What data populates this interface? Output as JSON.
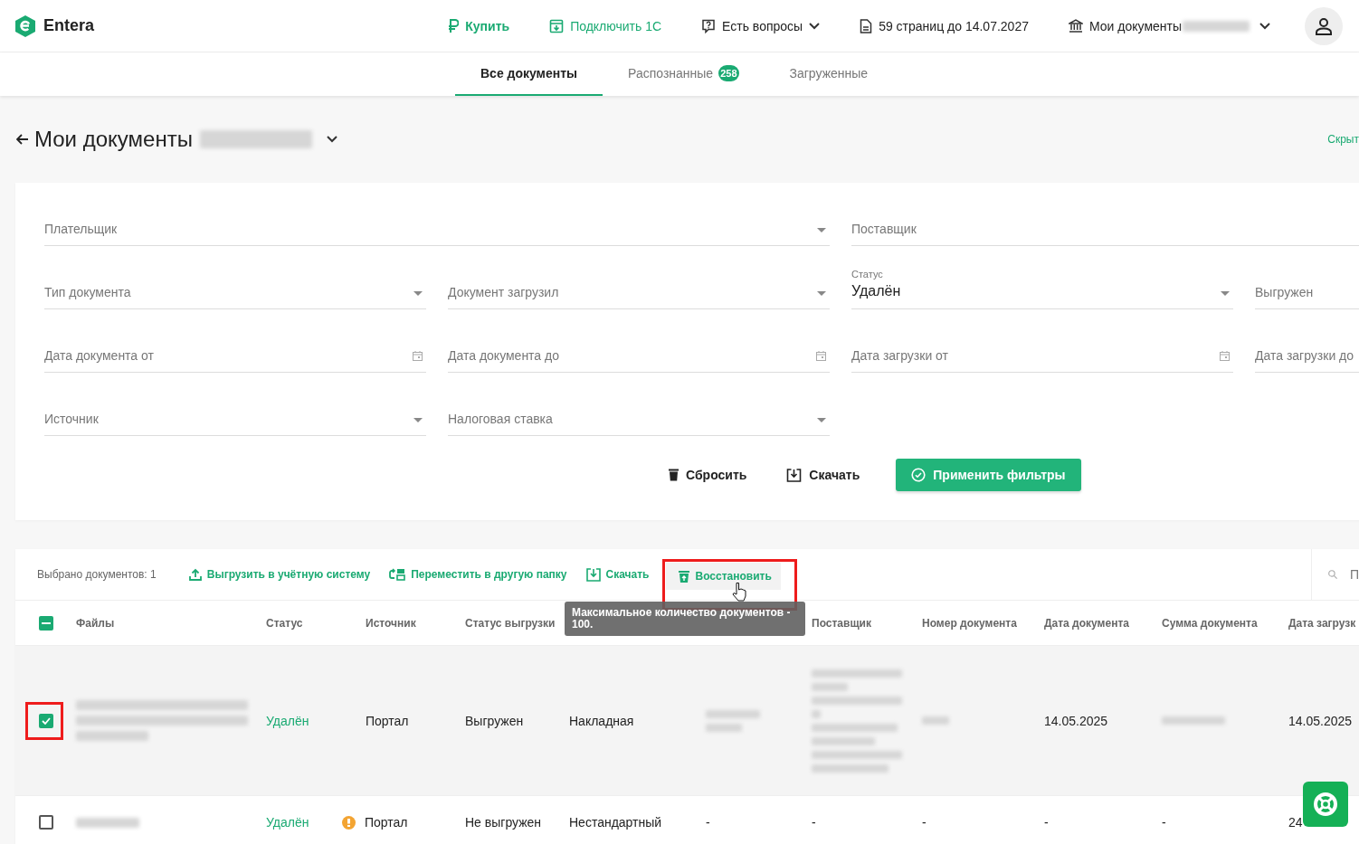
{
  "header": {
    "logo": "Entera",
    "nav": [
      {
        "kind": "buy",
        "label": "Купить"
      },
      {
        "kind": "connect",
        "label": "Подключить 1С"
      },
      {
        "kind": "help",
        "label": "Есть вопросы"
      },
      {
        "kind": "pages",
        "label": "59 страниц до 14.07.2027"
      },
      {
        "kind": "docs",
        "label": "Мои документы"
      }
    ]
  },
  "tabs": [
    {
      "label": "Все документы",
      "selected": true
    },
    {
      "label": "Распознанные",
      "badge": "258",
      "selected": false
    },
    {
      "label": "Загруженные",
      "selected": false
    }
  ],
  "page_title": "Мои документы",
  "hide_link": "Скрыт",
  "filter_rows": [
    [
      {
        "kind": "select",
        "label": "Плательщик"
      },
      {
        "kind": "text",
        "label": "Поставщик"
      }
    ],
    [
      {
        "kind": "select",
        "label": "Тип документа"
      },
      {
        "kind": "select",
        "label": "Документ загрузил"
      },
      {
        "kind": "select",
        "label": "Статус",
        "value": "Удалён"
      },
      {
        "kind": "text",
        "label": "Выгружен"
      }
    ],
    [
      {
        "kind": "date",
        "label": "Дата документа от"
      },
      {
        "kind": "date",
        "label": "Дата документа до"
      },
      {
        "kind": "date",
        "label": "Дата загрузки от"
      },
      {
        "kind": "text",
        "label": "Дата загрузки до"
      }
    ],
    [
      {
        "kind": "select",
        "label": "Источник"
      },
      {
        "kind": "select",
        "label": "Налоговая ставка"
      }
    ]
  ],
  "filter_buttons": [
    {
      "kind": "reset",
      "label": "Сбросить"
    },
    {
      "kind": "download",
      "label": "Скачать"
    },
    {
      "kind": "apply",
      "label": "Применить фильтры"
    }
  ],
  "toolbar": {
    "selected_count": "Выбрано документов: 1",
    "actions": [
      {
        "kind": "upload",
        "label": "Выгрузить в учётную систему",
        "highlighted": false
      },
      {
        "kind": "move",
        "label": "Переместить в другую папку",
        "highlighted": false
      },
      {
        "kind": "download",
        "label": "Скачать",
        "highlighted": false
      },
      {
        "kind": "restore",
        "label": "Восстановить",
        "highlighted": true
      }
    ],
    "tooltip": "Максимальное количество документов - 100.",
    "search_placeholder": "П"
  },
  "table": {
    "select_all_partial": true,
    "columns": [
      "Файлы",
      "Статус",
      "Источник",
      "Статус выгрузки"
    ],
    "columns_after_tooltip": [
      "Поставщик",
      "Номер документа",
      "Дата документа",
      "Сумма документа",
      "Дата загрузк"
    ],
    "rows": [
      {
        "selected": true,
        "highlighted": true,
        "cells": [
          {
            "kind": "redacted"
          },
          {
            "kind": "status",
            "text": "Удалён"
          },
          {
            "kind": "text",
            "text": "Портал"
          },
          {
            "kind": "text",
            "text": "Выгружен"
          },
          {
            "kind": "text",
            "text": "Накладная"
          },
          {
            "kind": "redacted"
          },
          {
            "kind": "redacted"
          },
          {
            "kind": "redacted"
          },
          {
            "kind": "text",
            "text": "14.05.2025"
          },
          {
            "kind": "redacted"
          },
          {
            "kind": "text",
            "text": "14.05.2025"
          }
        ]
      },
      {
        "selected": false,
        "highlighted": false,
        "cells": [
          {
            "kind": "redacted"
          },
          {
            "kind": "status",
            "text": "Удалён"
          },
          {
            "kind": "warning",
            "text": "Портал"
          },
          {
            "kind": "text",
            "text": "Не выгружен"
          },
          {
            "kind": "text",
            "text": "Нестандартный"
          },
          {
            "kind": "text",
            "text": "-"
          },
          {
            "kind": "text",
            "text": "-"
          },
          {
            "kind": "text",
            "text": "-"
          },
          {
            "kind": "text",
            "text": "-"
          },
          {
            "kind": "text",
            "text": "-"
          },
          {
            "kind": "text",
            "text": "24"
          }
        ]
      }
    ]
  }
}
